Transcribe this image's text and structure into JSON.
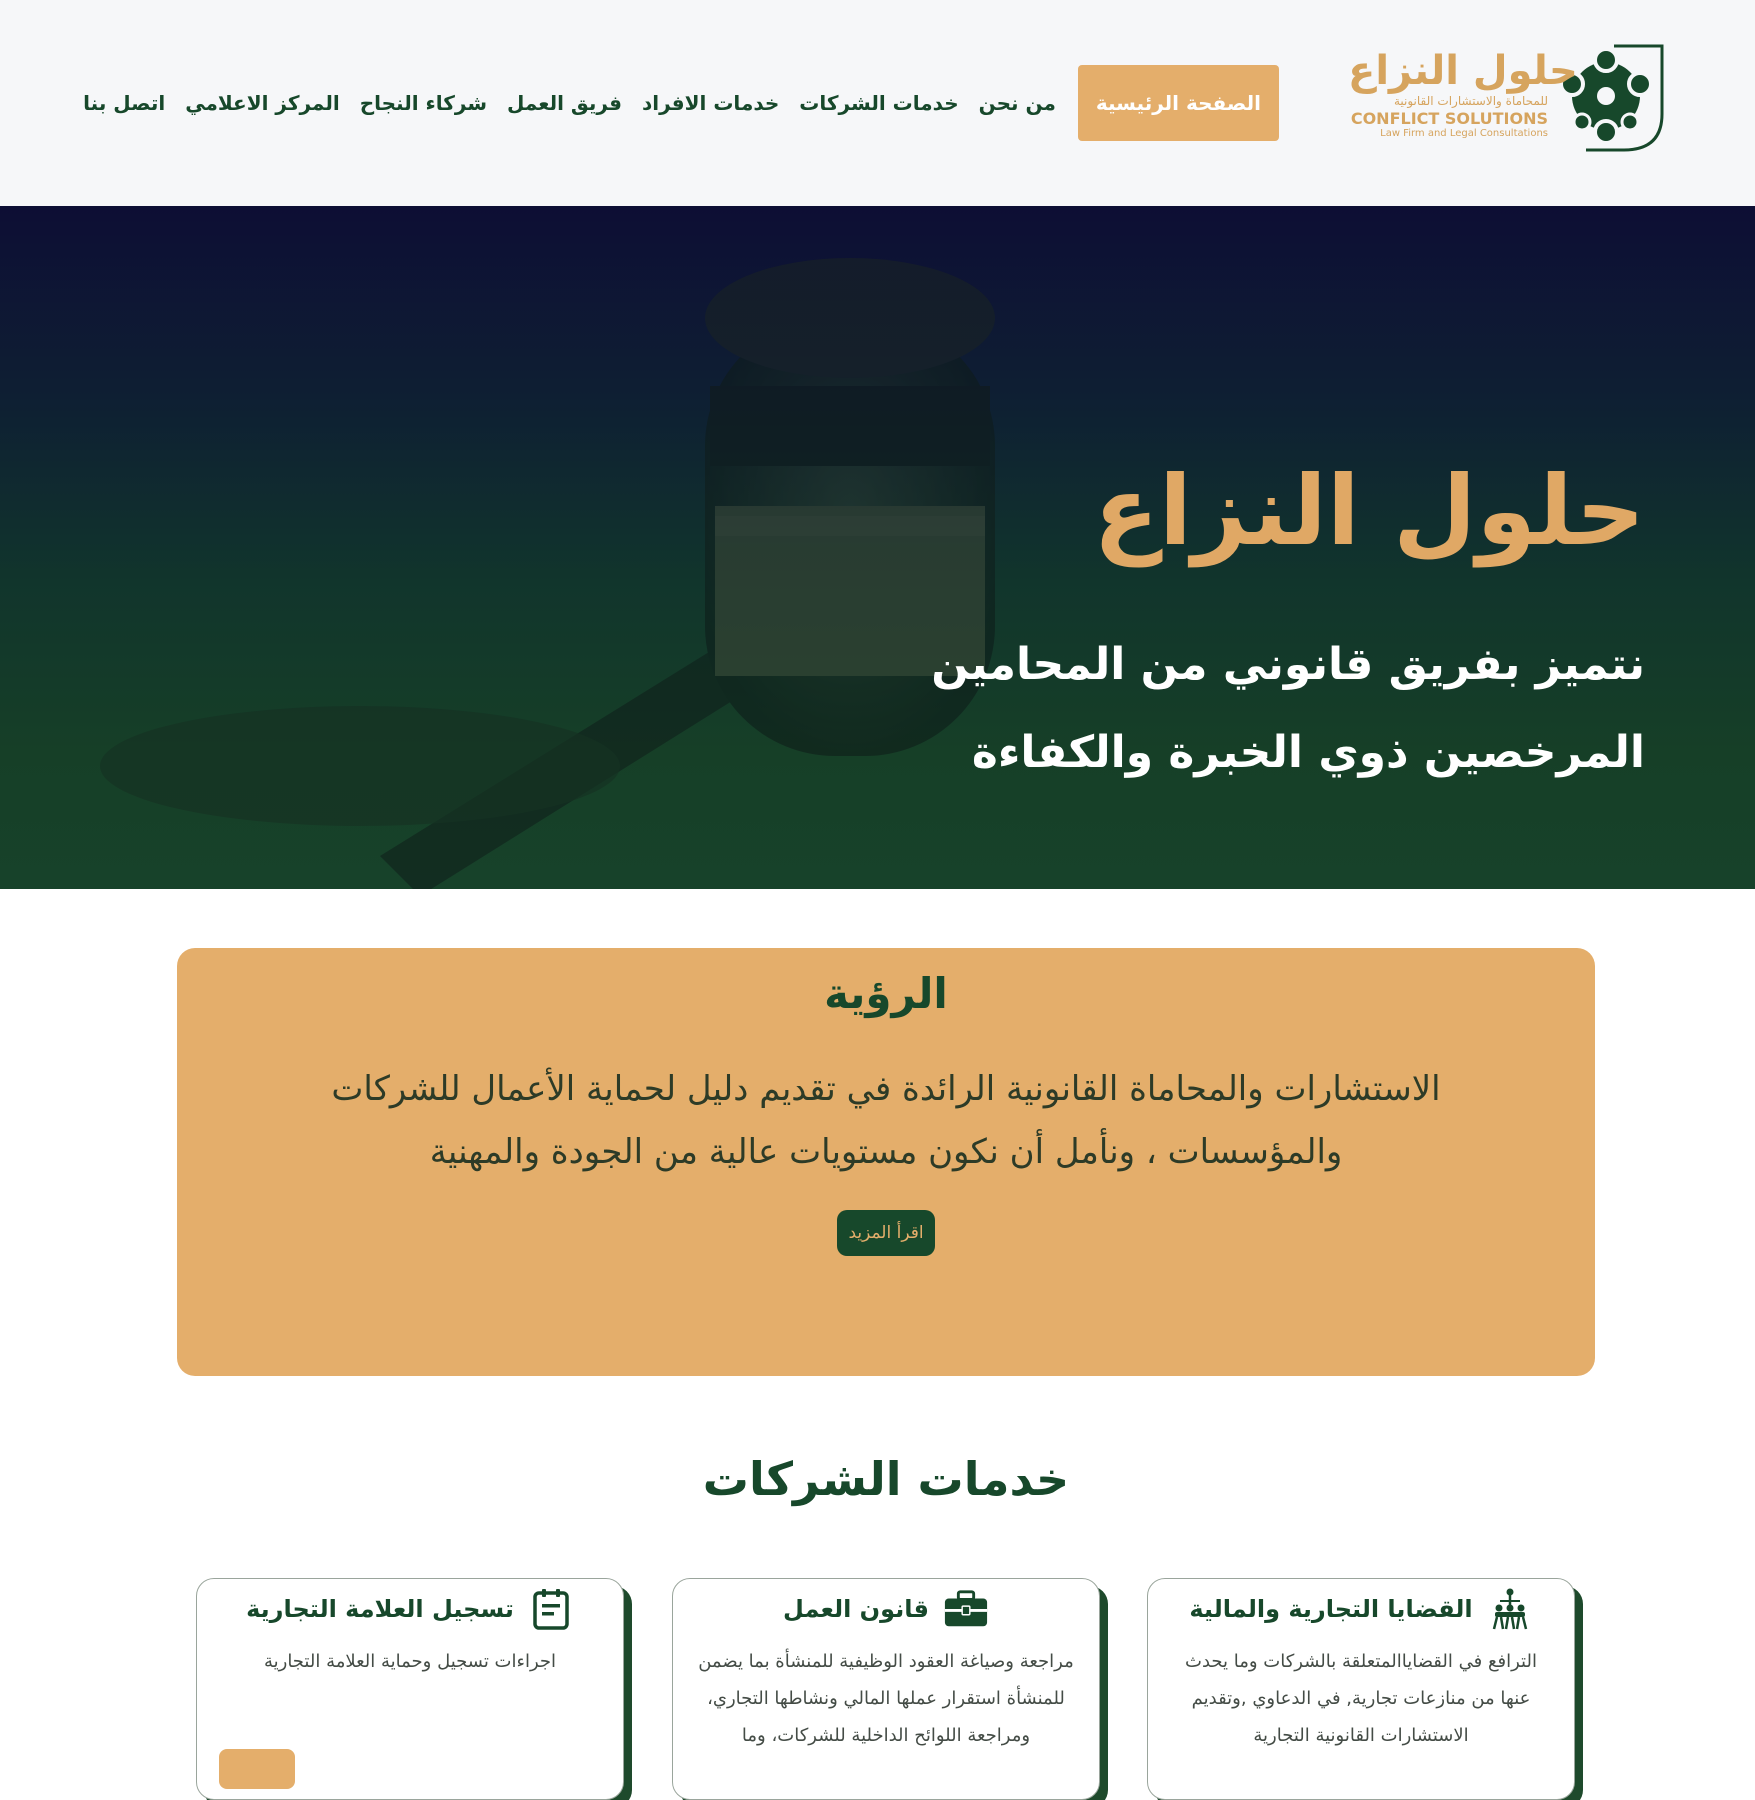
{
  "header": {
    "logo": {
      "name_ar": "حلول النزاع",
      "subtitle_ar": "للمحاماة والاستشارات القانونية",
      "name_en": "CONFLICT SOLUTIONS",
      "subtitle_en": "Law Firm and Legal Consultations"
    },
    "nav": {
      "active": "الصفحة الرئيسية",
      "items": [
        "من نحن",
        "خدمات الشركات",
        "خدمات الافراد",
        "فريق العمل",
        "شركاء النجاح",
        "المركز الاعلامي",
        "اتصل بنا"
      ]
    }
  },
  "hero": {
    "title": "حلول النزاع",
    "subtitle_line1": "نتميز بفريق قانوني من المحامين",
    "subtitle_line2": "المرخصين ذوي الخبرة والكفاءة"
  },
  "values_card": {
    "title": "الرؤية",
    "text": "الاستشارات والمحاماة القانونية الرائدة في تقديم دليل لحماية الأعمال للشركات والمؤسسات ، ونأمل أن نكون مستويات عالية من الجودة والمهنية",
    "button": "اقرأ المزيد"
  },
  "services": {
    "title": "خدمات الشركات",
    "cards": [
      {
        "title": "القضايا التجارية والمالية",
        "icon": "people-network-icon",
        "desc": "الترافع في القضاياالمتعلقة بالشركات وما يحدث عنها من منازعات تجارية, في الدعاوي ,وتقديم الاستشارات القانونية التجارية"
      },
      {
        "title": "قانون العمل",
        "icon": "briefcase-icon",
        "desc": "مراجعة وصياغة العقود الوظيفية للمنشأة بما يضمن للمنشأة استقرار عملها المالي ونشاطها التجاري، ومراجعة اللوائح الداخلية للشركات، وما"
      },
      {
        "title": "تسجيل العلامة التجارية",
        "icon": "document-icon",
        "desc": "اجراءات تسجيل وحماية العلامة التجارية"
      }
    ]
  },
  "colors": {
    "primary_green": "#17482b",
    "gold": "#e4ae6b",
    "header_bg": "#f6f7f9"
  }
}
